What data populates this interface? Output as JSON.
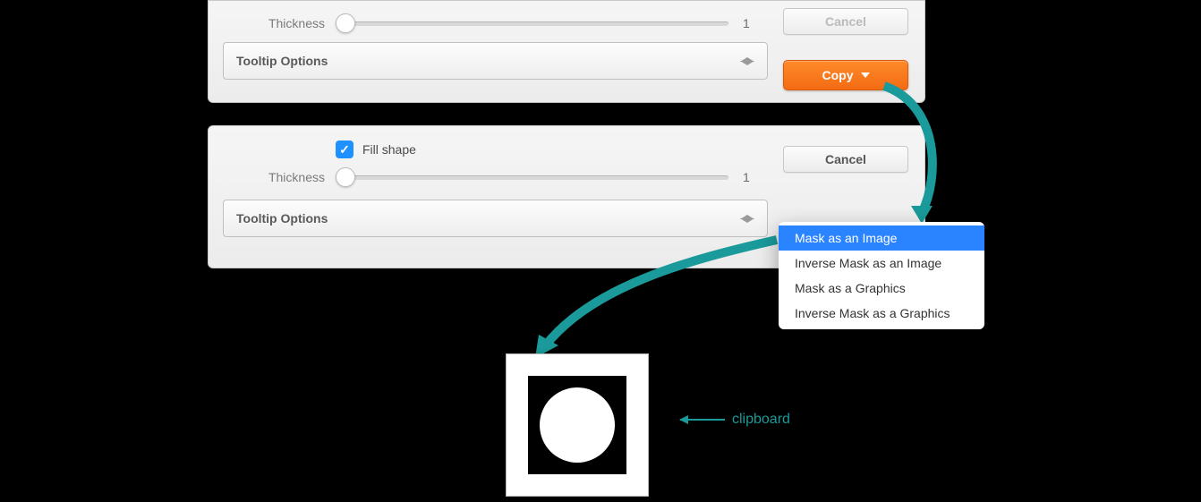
{
  "panel1": {
    "thickness_label": "Thickness",
    "thickness_value": "1",
    "accordion_label": "Tooltip Options",
    "cancel_label": "Cancel",
    "copy_label": "Copy"
  },
  "panel2": {
    "fill_shape_label": "Fill shape",
    "fill_shape_checked": true,
    "thickness_label": "Thickness",
    "thickness_value": "1",
    "accordion_label": "Tooltip Options",
    "cancel_label": "Cancel"
  },
  "menu": {
    "items": [
      "Mask as an Image",
      "Inverse Mask as an Image",
      "Mask as a Graphics",
      "Inverse Mask as a Graphics"
    ],
    "selected_index": 0
  },
  "annotation": {
    "clipboard_label": "clipboard"
  },
  "colors": {
    "accent_orange": "#f4711a",
    "accent_blue": "#2b84ff",
    "teal": "#1a9a9a"
  }
}
